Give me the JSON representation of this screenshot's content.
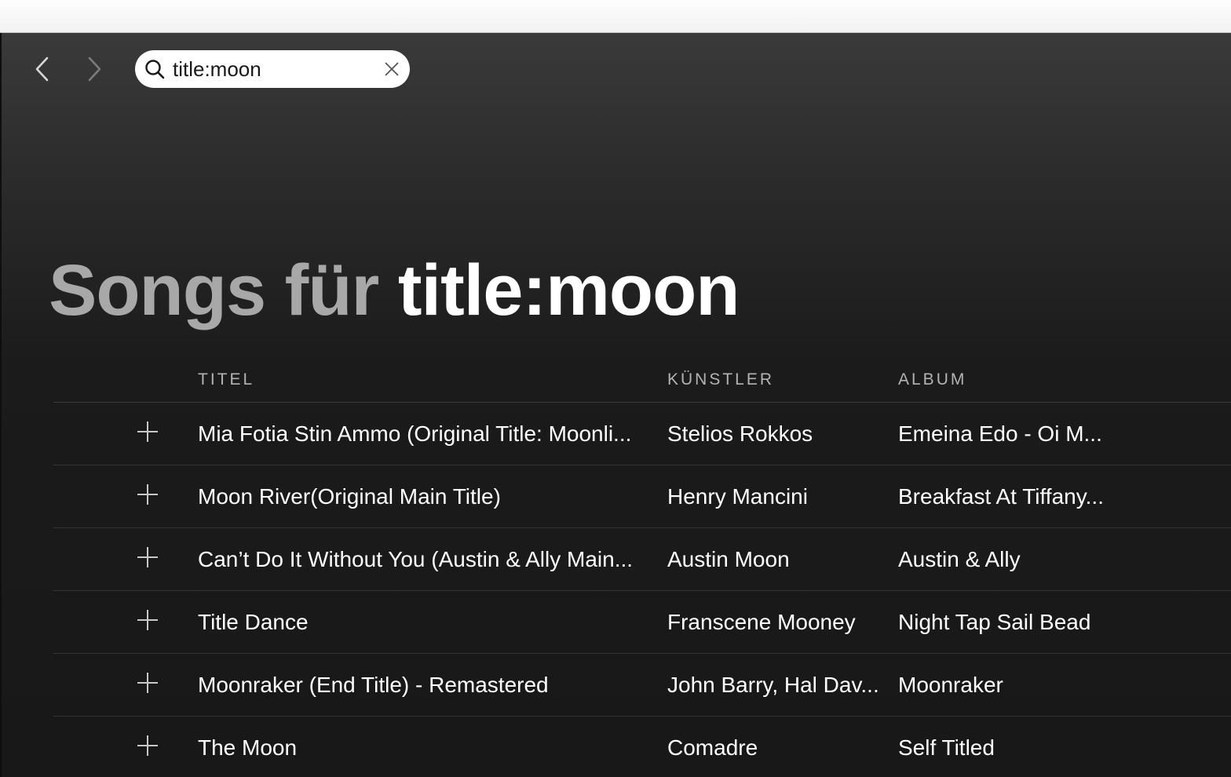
{
  "navigation": {
    "back_icon": "chevron-left-icon",
    "forward_icon": "chevron-right-icon"
  },
  "search": {
    "value": "title:moon",
    "icon": "search-icon",
    "clear_icon": "close-icon"
  },
  "page": {
    "title_prefix": "Songs für",
    "title_query": "title:moon"
  },
  "table": {
    "headers": {
      "title": "TITEL",
      "artist": "KÜNSTLER",
      "album": "ALBUM"
    },
    "rows": [
      {
        "title": "Mia Fotia Stin Ammo (Original Title: Moonli...",
        "artist": "Stelios Rokkos",
        "album": "Emeina Edo - Oi M..."
      },
      {
        "title": "Moon River(Original Main Title)",
        "artist": "Henry Mancini",
        "album": "Breakfast At Tiffany..."
      },
      {
        "title": "Can’t Do It Without You (Austin & Ally Main...",
        "artist": "Austin Moon",
        "album": "Austin & Ally"
      },
      {
        "title": "Title Dance",
        "artist": "Franscene Mooney",
        "album": "Night Tap Sail Bead"
      },
      {
        "title": "Moonraker (End Title) - Remastered",
        "artist": "John Barry, Hal Dav...",
        "album": "Moonraker"
      },
      {
        "title": "The Moon",
        "artist": "Comadre",
        "album": "Self Titled"
      }
    ]
  },
  "colors": {
    "background": "#181818",
    "header_gradient_top": "#3a3a3a",
    "text_primary": "#ffffff",
    "text_muted": "#a8a8a8"
  }
}
